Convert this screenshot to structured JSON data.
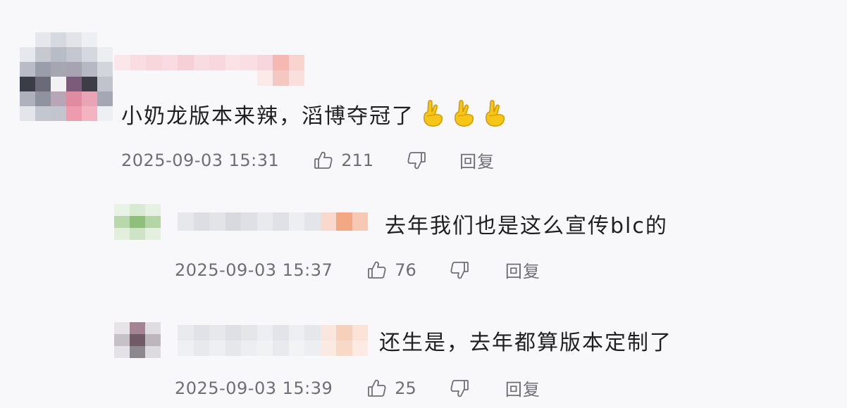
{
  "comments": [
    {
      "text": "小奶龙版本来辣，滔博夺冠了",
      "emoji": [
        "fingers-crossed-icon",
        "fingers-crossed-icon",
        "fingers-crossed-icon"
      ],
      "timestamp": "2025-09-03 15:31",
      "likes": "211",
      "reply_label": "回复"
    },
    {
      "text": "去年我们也是这么宣传blc的",
      "timestamp": "2025-09-03 15:37",
      "likes": "76",
      "reply_label": "回复"
    },
    {
      "text": "还生是，去年都算版本定制了",
      "timestamp": "2025-09-03 15:39",
      "likes": "25",
      "reply_label": "回复"
    }
  ],
  "colors": {
    "background": "#f8f8fa",
    "text": "#1f1f1f",
    "meta": "#6e6e76",
    "emoji": "#f5c518"
  }
}
